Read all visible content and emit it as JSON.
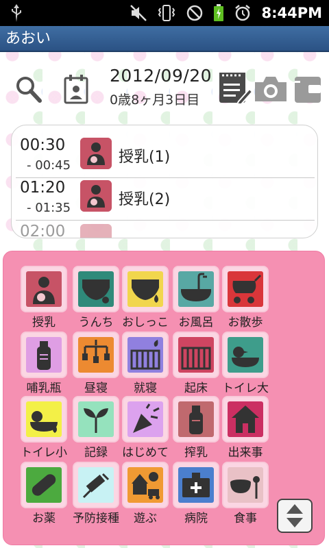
{
  "status_bar": {
    "time": "8:44PM"
  },
  "title": "あおい",
  "header": {
    "date": "2012/09/20",
    "age": "0歳8ヶ月3日目"
  },
  "log": [
    {
      "start": "00:30",
      "end": "- 00:45",
      "label": "授乳(1)"
    },
    {
      "start": "01:20",
      "end": "- 01:35",
      "label": "授乳(2)"
    },
    {
      "start": "02:00"
    }
  ],
  "buttons": [
    {
      "label": "授乳",
      "icon": "nursing-icon",
      "color": "#c75366"
    },
    {
      "label": "うんち",
      "icon": "diaper-poop-icon",
      "color": "#2f8a7a"
    },
    {
      "label": "おしっこ",
      "icon": "diaper-pee-icon",
      "color": "#f1d64d"
    },
    {
      "label": "お風呂",
      "icon": "bathtub-icon",
      "color": "#58a8a4"
    },
    {
      "label": "お散歩",
      "icon": "stroller-icon",
      "color": "#d9363a"
    },
    {
      "label": "哺乳瓶",
      "icon": "baby-bottle-icon",
      "color": "#df9ee4"
    },
    {
      "label": "昼寝",
      "icon": "mobile-toy-icon",
      "color": "#ec8a31"
    },
    {
      "label": "就寝",
      "icon": "crib-night-icon",
      "color": "#9080df"
    },
    {
      "label": "起床",
      "icon": "crib-day-icon",
      "color": "#cf4561"
    },
    {
      "label": "トイレ大",
      "icon": "duck-potty-icon",
      "color": "#3e9d8b"
    },
    {
      "label": "トイレ小",
      "icon": "duck-small-icon",
      "color": "#f3f047"
    },
    {
      "label": "記録",
      "icon": "sprout-icon",
      "color": "#95e2bd"
    },
    {
      "label": "はじめて",
      "icon": "party-popper-icon",
      "color": "#dca2ee"
    },
    {
      "label": "搾乳",
      "icon": "milk-bottle-icon",
      "color": "#c0696e"
    },
    {
      "label": "出来事",
      "icon": "house-icon",
      "color": "#cb2f62"
    },
    {
      "label": "お薬",
      "icon": "capsule-icon",
      "color": "#4caa3f"
    },
    {
      "label": "予防接種",
      "icon": "syringe-icon",
      "color": "#c8f2f4"
    },
    {
      "label": "遊ぶ",
      "icon": "toys-icon",
      "color": "#f09a33"
    },
    {
      "label": "病院",
      "icon": "hospital-icon",
      "color": "#4b7fce"
    },
    {
      "label": "食事",
      "icon": "bowl-spoon-icon",
      "color": "#e9c1c6"
    }
  ],
  "colors": {
    "title_bar": "#2b5284",
    "panel": "#f590b2"
  }
}
